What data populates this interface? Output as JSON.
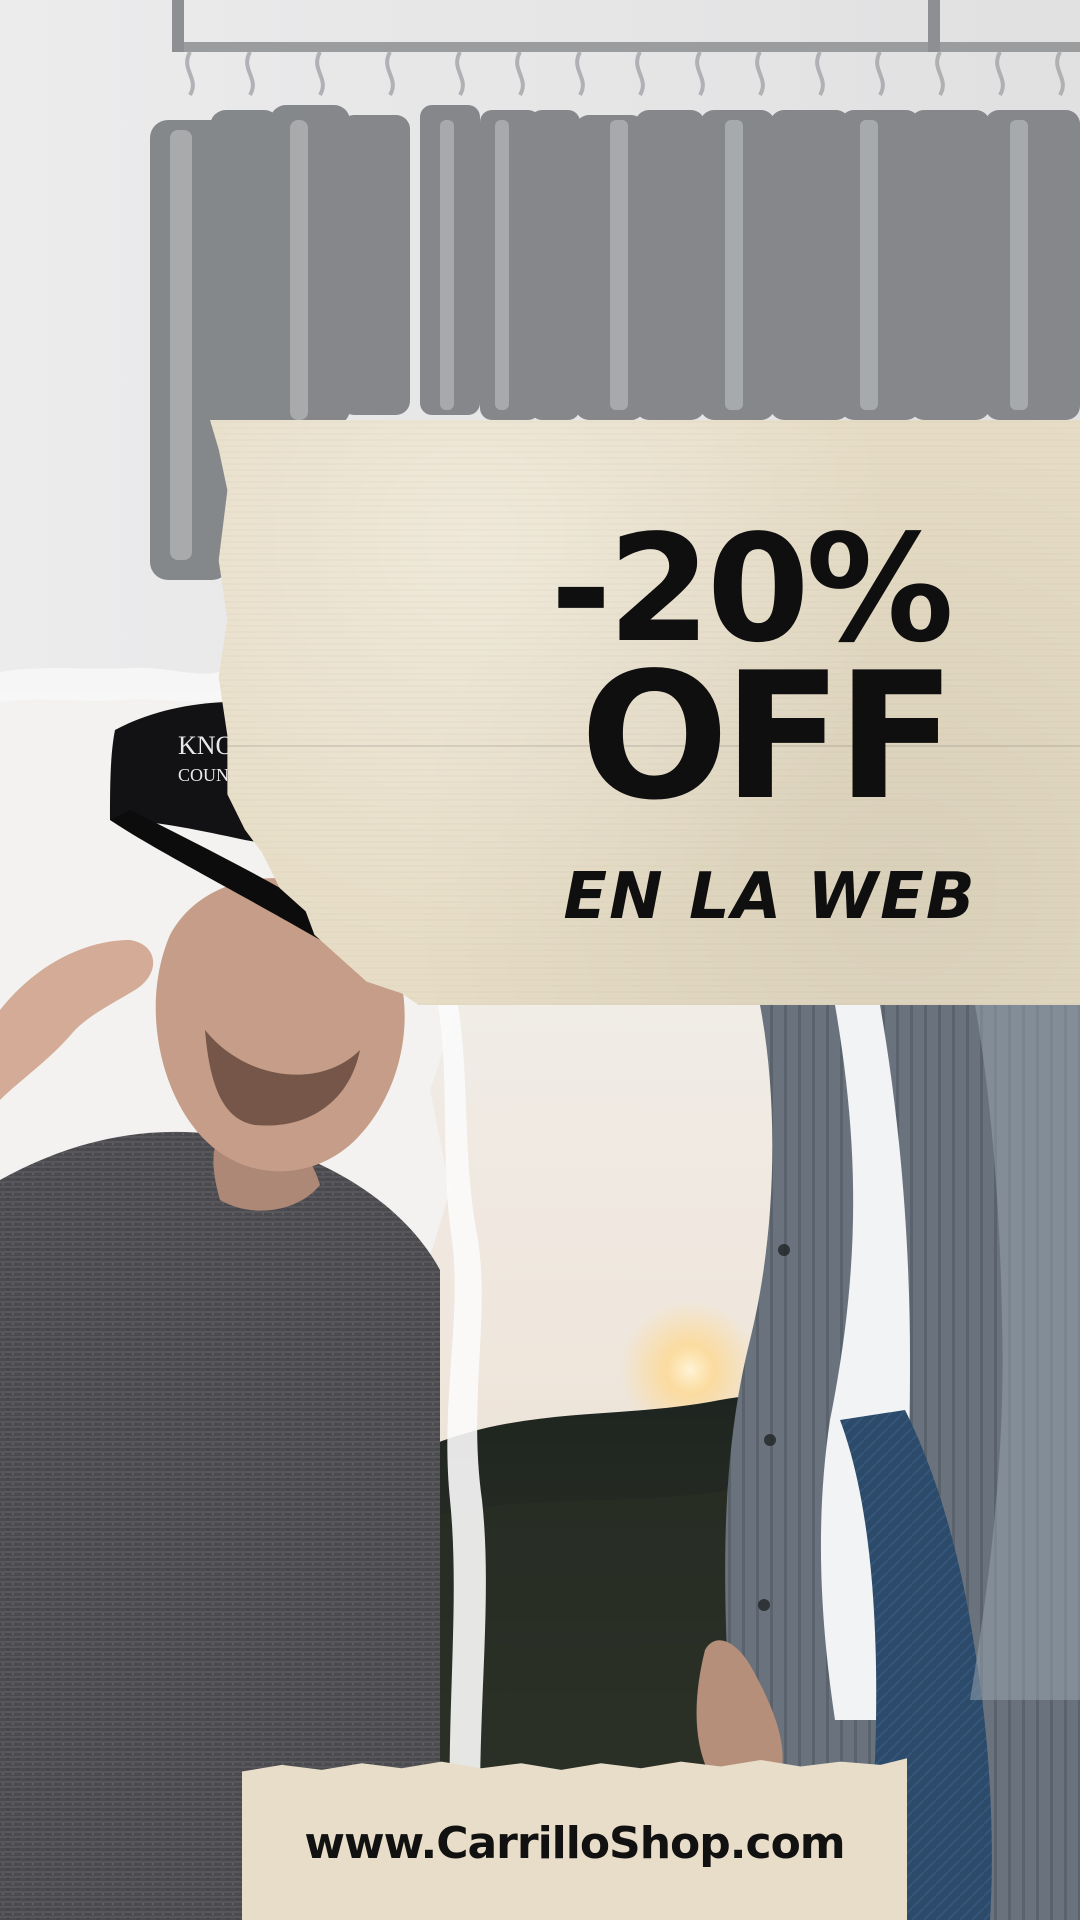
{
  "promo": {
    "discount": "-20%",
    "off": "OFF",
    "subline": "EN LA WEB",
    "cap_logo_text_1": "KNO",
    "cap_logo_text_2": "COUNTR"
  },
  "footer": {
    "url": "www.CarrilloShop.com"
  },
  "colors": {
    "paper": "#e7ddc6",
    "text": "#0f0f0f"
  },
  "icons": {
    "top_photo": "clothing-rack-photo",
    "bottom_left_photo": "man-in-cap-photo",
    "bottom_right_photo": "shirt-and-jeans-photo"
  }
}
